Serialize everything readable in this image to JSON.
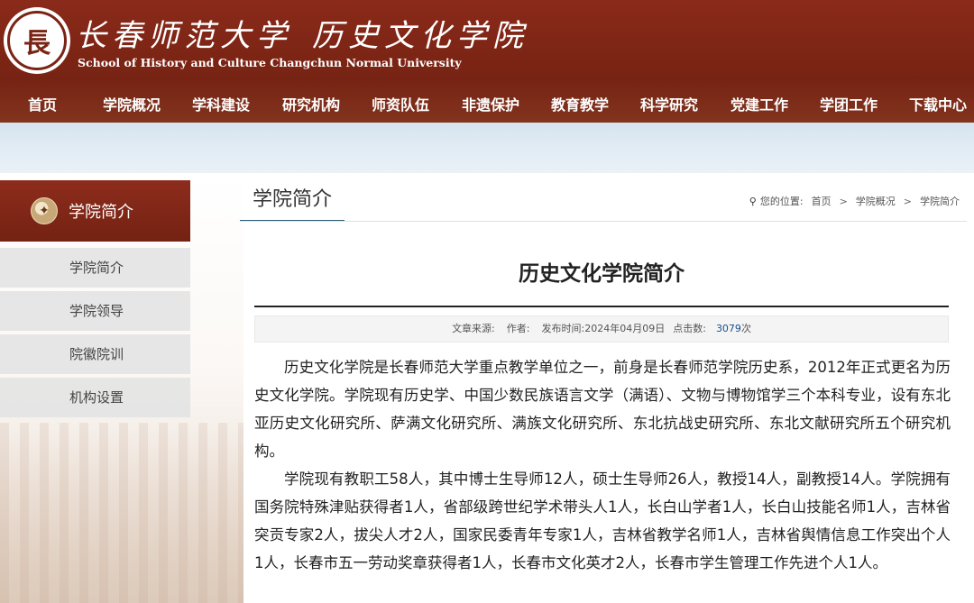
{
  "header": {
    "school_cn": "长春师范大学",
    "college_cn": "历史文化学院",
    "school_en": "School of History and Culture Changchun Normal University",
    "seal_char": "長"
  },
  "nav": [
    {
      "label": "首页"
    },
    {
      "label": "学院概况"
    },
    {
      "label": "学科建设"
    },
    {
      "label": "研究机构"
    },
    {
      "label": "师资队伍"
    },
    {
      "label": "非遗保护"
    },
    {
      "label": "教育教学"
    },
    {
      "label": "科学研究"
    },
    {
      "label": "党建工作"
    },
    {
      "label": "学团工作"
    },
    {
      "label": "下载中心"
    }
  ],
  "sidebar": {
    "title": "学院简介",
    "items": [
      {
        "label": "学院简介"
      },
      {
        "label": "学院领导"
      },
      {
        "label": "院徽院训"
      },
      {
        "label": "机构设置"
      }
    ]
  },
  "main": {
    "section_title": "学院简介",
    "breadcrumb": {
      "prefix": "您的位置:",
      "items": [
        "首页",
        "学院概况",
        "学院简介"
      ],
      "separator": ">"
    },
    "article": {
      "title": "历史文化学院简介",
      "meta": {
        "source_label": "文章来源:",
        "author_label": "作者:",
        "date_label": "发布时间:",
        "date": "2024年04月09日",
        "hits_label": "点击数:",
        "hits": "3079",
        "hits_unit": "次"
      },
      "paragraphs": [
        "历史文化学院是长春师范大学重点教学单位之一，前身是长春师范学院历史系，2012年正式更名为历史文化学院。学院现有历史学、中国少数民族语言文学（满语）、文物与博物馆学三个本科专业，设有东北亚历史文化研究所、萨满文化研究所、满族文化研究所、东北抗战史研究所、东北文献研究所五个研究机构。",
        "学院现有教职工58人，其中博士生导师12人，硕士生导师26人，教授14人，副教授14人。学院拥有国务院特殊津贴获得者1人，省部级跨世纪学术带头人1人，长白山学者1人，长白山技能名师1人，吉林省突贡专家2人，拔尖人才2人，国家民委青年专家1人，吉林省教学名师1人，吉林省舆情信息工作突出个人1人，长春市五一劳动奖章获得者1人，长春市文化英才2人，长春市学生管理工作先进个人1人。"
      ]
    }
  },
  "colors": {
    "header_red": "#7a2414",
    "sidebar_red": "#8d2c1c",
    "accent_blue": "#2e5e7a",
    "hits_blue": "#1a4e8a"
  },
  "icons": {
    "seal": "university-seal-icon",
    "globe": "globe-icon",
    "pin": "location-pin-icon"
  }
}
